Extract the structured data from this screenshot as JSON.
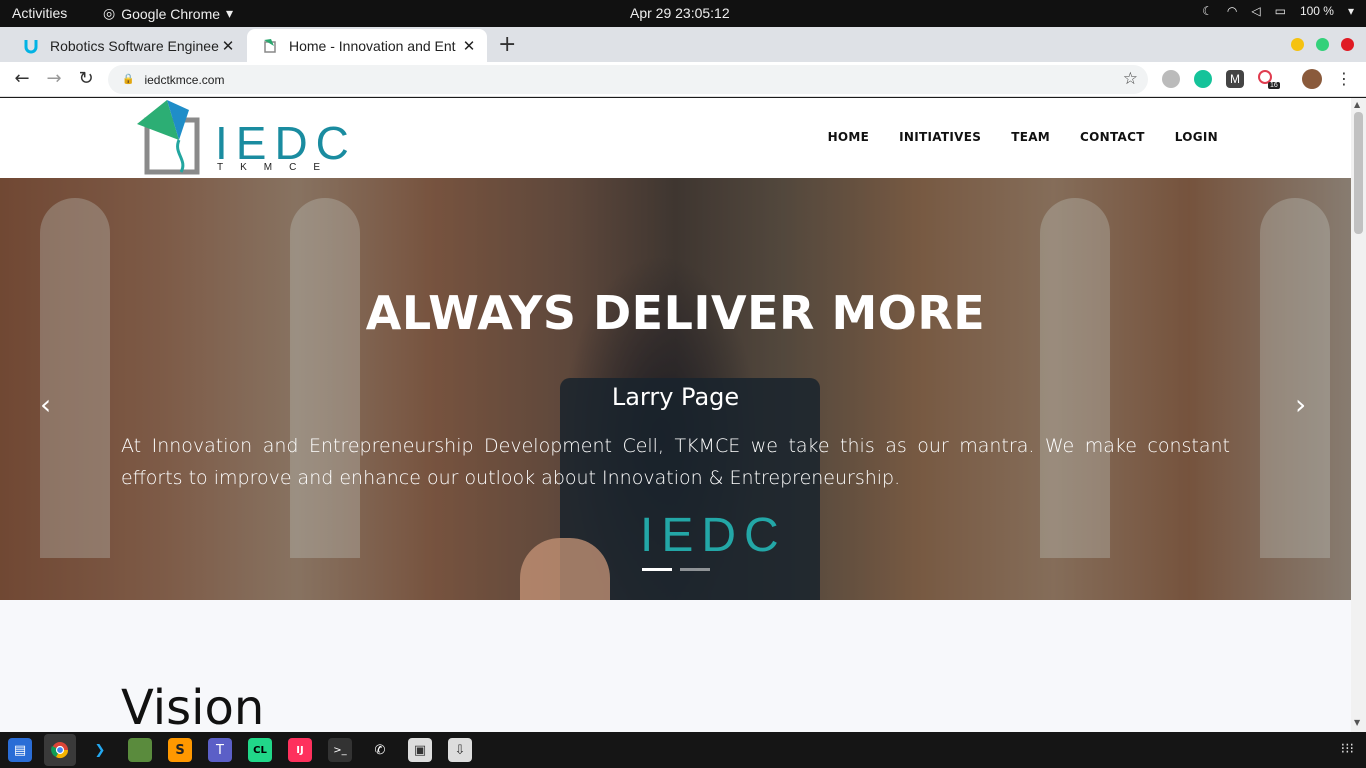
{
  "system": {
    "activities": "Activities",
    "app_name": "Google Chrome",
    "datetime": "Apr 29  23:05:12",
    "battery": "100 %"
  },
  "browser": {
    "tabs": [
      {
        "title": "Robotics Software Enginee",
        "favicon": "udacity-icon",
        "active": false
      },
      {
        "title": "Home - Innovation and Ent",
        "favicon": "iedc-icon",
        "active": true
      }
    ],
    "new_tab": "+",
    "url": "iedctkmce.com",
    "extensions": [
      "database-icon",
      "grammarly-icon",
      "m-icon",
      "badge-icon",
      "avatar"
    ],
    "extension_badge": "16"
  },
  "site": {
    "logo_text": "IEDC",
    "logo_sub": "TKMCE",
    "nav": [
      "HOME",
      "INITIATIVES",
      "TEAM",
      "CONTACT",
      "LOGIN"
    ],
    "hero": {
      "title": "ALWAYS DELIVER MORE",
      "author": "Larry Page",
      "text": "At Innovation and Entrepreneurship Development Cell, TKMCE we take this as our mantra. We make constant efforts to improve and enhance our outlook about Innovation & Entrepreneurship.",
      "phone_brand": "IEDC",
      "prev": "‹",
      "next": "›",
      "slides": 2,
      "active_slide": 1
    },
    "section_heading": "Vision"
  },
  "taskbar": {
    "apps": [
      "files-icon",
      "chrome-icon",
      "vscode-icon",
      "minecraft-icon",
      "sublime-icon",
      "teams-icon",
      "clion-icon",
      "intellij-icon",
      "terminal-icon",
      "phone-icon",
      "archive-icon",
      "install-icon"
    ]
  }
}
